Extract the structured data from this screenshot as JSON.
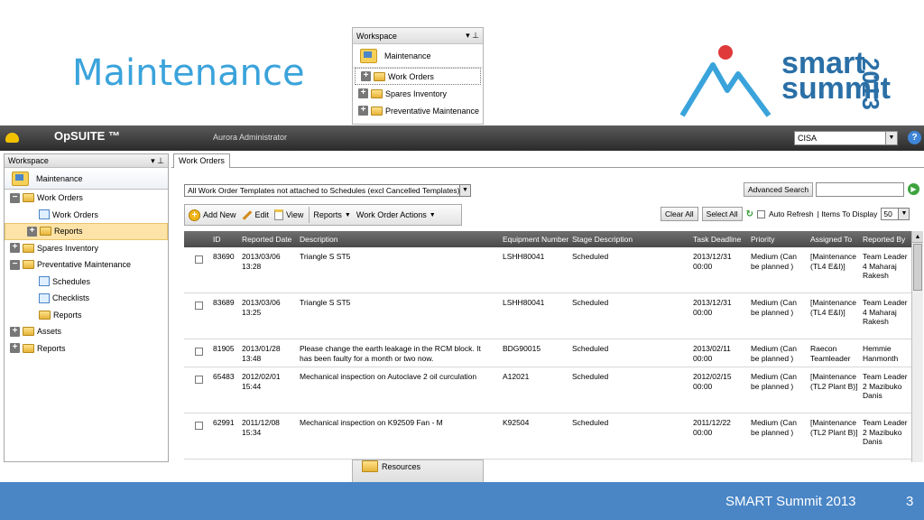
{
  "slide": {
    "title": "Maintenance",
    "footer_text": "SMART Summit 2013",
    "page_number": "3",
    "logo_line1": "smart",
    "logo_line2": "summit",
    "logo_year": "2013"
  },
  "float_panel": {
    "header": "Workspace",
    "maintenance": "Maintenance",
    "items": [
      "Work Orders",
      "Spares Inventory",
      "Preventative Maintenance"
    ],
    "bottom_item": "Resources"
  },
  "app": {
    "brand": "OpSUITE ™",
    "user": "Aurora Administrator",
    "tenant": "CISA"
  },
  "workspace": {
    "header": "Workspace",
    "maintenance": "Maintenance",
    "tree": [
      {
        "label": "Work Orders",
        "level": 0,
        "icon": "folder",
        "toggle": "−"
      },
      {
        "label": "Work Orders",
        "level": 1,
        "icon": "doc"
      },
      {
        "label": "Reports",
        "level": 1,
        "icon": "folder",
        "toggle": "+",
        "selected": true
      },
      {
        "label": "Spares Inventory",
        "level": 0,
        "icon": "folder",
        "toggle": "+"
      },
      {
        "label": "Preventative Maintenance",
        "level": 0,
        "icon": "folder",
        "toggle": "−"
      },
      {
        "label": "Schedules",
        "level": 1,
        "icon": "doc"
      },
      {
        "label": "Checklists",
        "level": 1,
        "icon": "doc"
      },
      {
        "label": "Reports",
        "level": 1,
        "icon": "folder"
      },
      {
        "label": "Assets",
        "level": 0,
        "icon": "folder",
        "toggle": "+"
      },
      {
        "label": "Reports",
        "level": 0,
        "icon": "folder",
        "toggle": "+"
      }
    ]
  },
  "main": {
    "tab": "Work Orders",
    "filter": "All Work Order Templates not attached to Schedules (excl Cancelled Templates)",
    "advanced_search": "Advanced Search",
    "toolbar": {
      "add_new": "Add New",
      "edit": "Edit",
      "view": "View",
      "reports": "Reports",
      "actions": "Work Order Actions"
    },
    "clear_all": "Clear All",
    "select_all": "Select All",
    "auto_refresh": "Auto Refresh",
    "items_to_display_label": "| Items To Display",
    "items_to_display": "50",
    "columns": [
      "ID",
      "Reported Date",
      "Description",
      "Equipment Number",
      "Stage Description",
      "Task Deadline",
      "Priority",
      "Assigned To",
      "Reported By"
    ],
    "rows": [
      {
        "id": "83690",
        "date": "2013/03/06 13:28",
        "desc": "Triangle S ST5",
        "equip": "LSHH80041",
        "stage": "Scheduled",
        "deadline": "2013/12/31 00:00",
        "priority": "Medium (Can be planned )",
        "assigned": "[Maintenance (TL4 E&I)]",
        "reported_by": "Team Leader 4 Maharaj Rakesh"
      },
      {
        "id": "83689",
        "date": "2013/03/06 13:25",
        "desc": "Triangle S ST5",
        "equip": "LSHH80041",
        "stage": "Scheduled",
        "deadline": "2013/12/31 00:00",
        "priority": "Medium (Can be planned )",
        "assigned": "[Maintenance (TL4 E&I)]",
        "reported_by": "Team Leader 4 Maharaj Rakesh"
      },
      {
        "id": "81905",
        "date": "2013/01/28 13:48",
        "desc": "Please change the earth leakage in the RCM block. It has been faulty for a month or two now.",
        "equip": "BDG90015",
        "stage": "Scheduled",
        "deadline": "2013/02/11 00:00",
        "priority": "Medium (Can be planned )",
        "assigned": "Raecon Teamleader",
        "reported_by": "Hemmie Hanmonth"
      },
      {
        "id": "65483",
        "date": "2012/02/01 15:44",
        "desc": "Mechanical inspection on Autoclave 2 oil curculation",
        "equip": "A12021",
        "stage": "Scheduled",
        "deadline": "2012/02/15 00:00",
        "priority": "Medium (Can be planned )",
        "assigned": "[Maintenance (TL2 Plant B)]",
        "reported_by": "Team Leader 2 Mazibuko Danis"
      },
      {
        "id": "62991",
        "date": "2011/12/08 15:34",
        "desc": "Mechanical inspection on K92509 Fan - M",
        "equip": "K92504",
        "stage": "Scheduled",
        "deadline": "2011/12/22 00:00",
        "priority": "Medium (Can be planned )",
        "assigned": "[Maintenance (TL2 Plant B)]",
        "reported_by": "Team Leader 2 Mazibuko Danis"
      }
    ]
  },
  "colors": {
    "title_blue": "#3aa3db",
    "footer_blue": "#4a86c6",
    "logo_red": "#e03a3a",
    "selected_row": "#fde3a7"
  }
}
